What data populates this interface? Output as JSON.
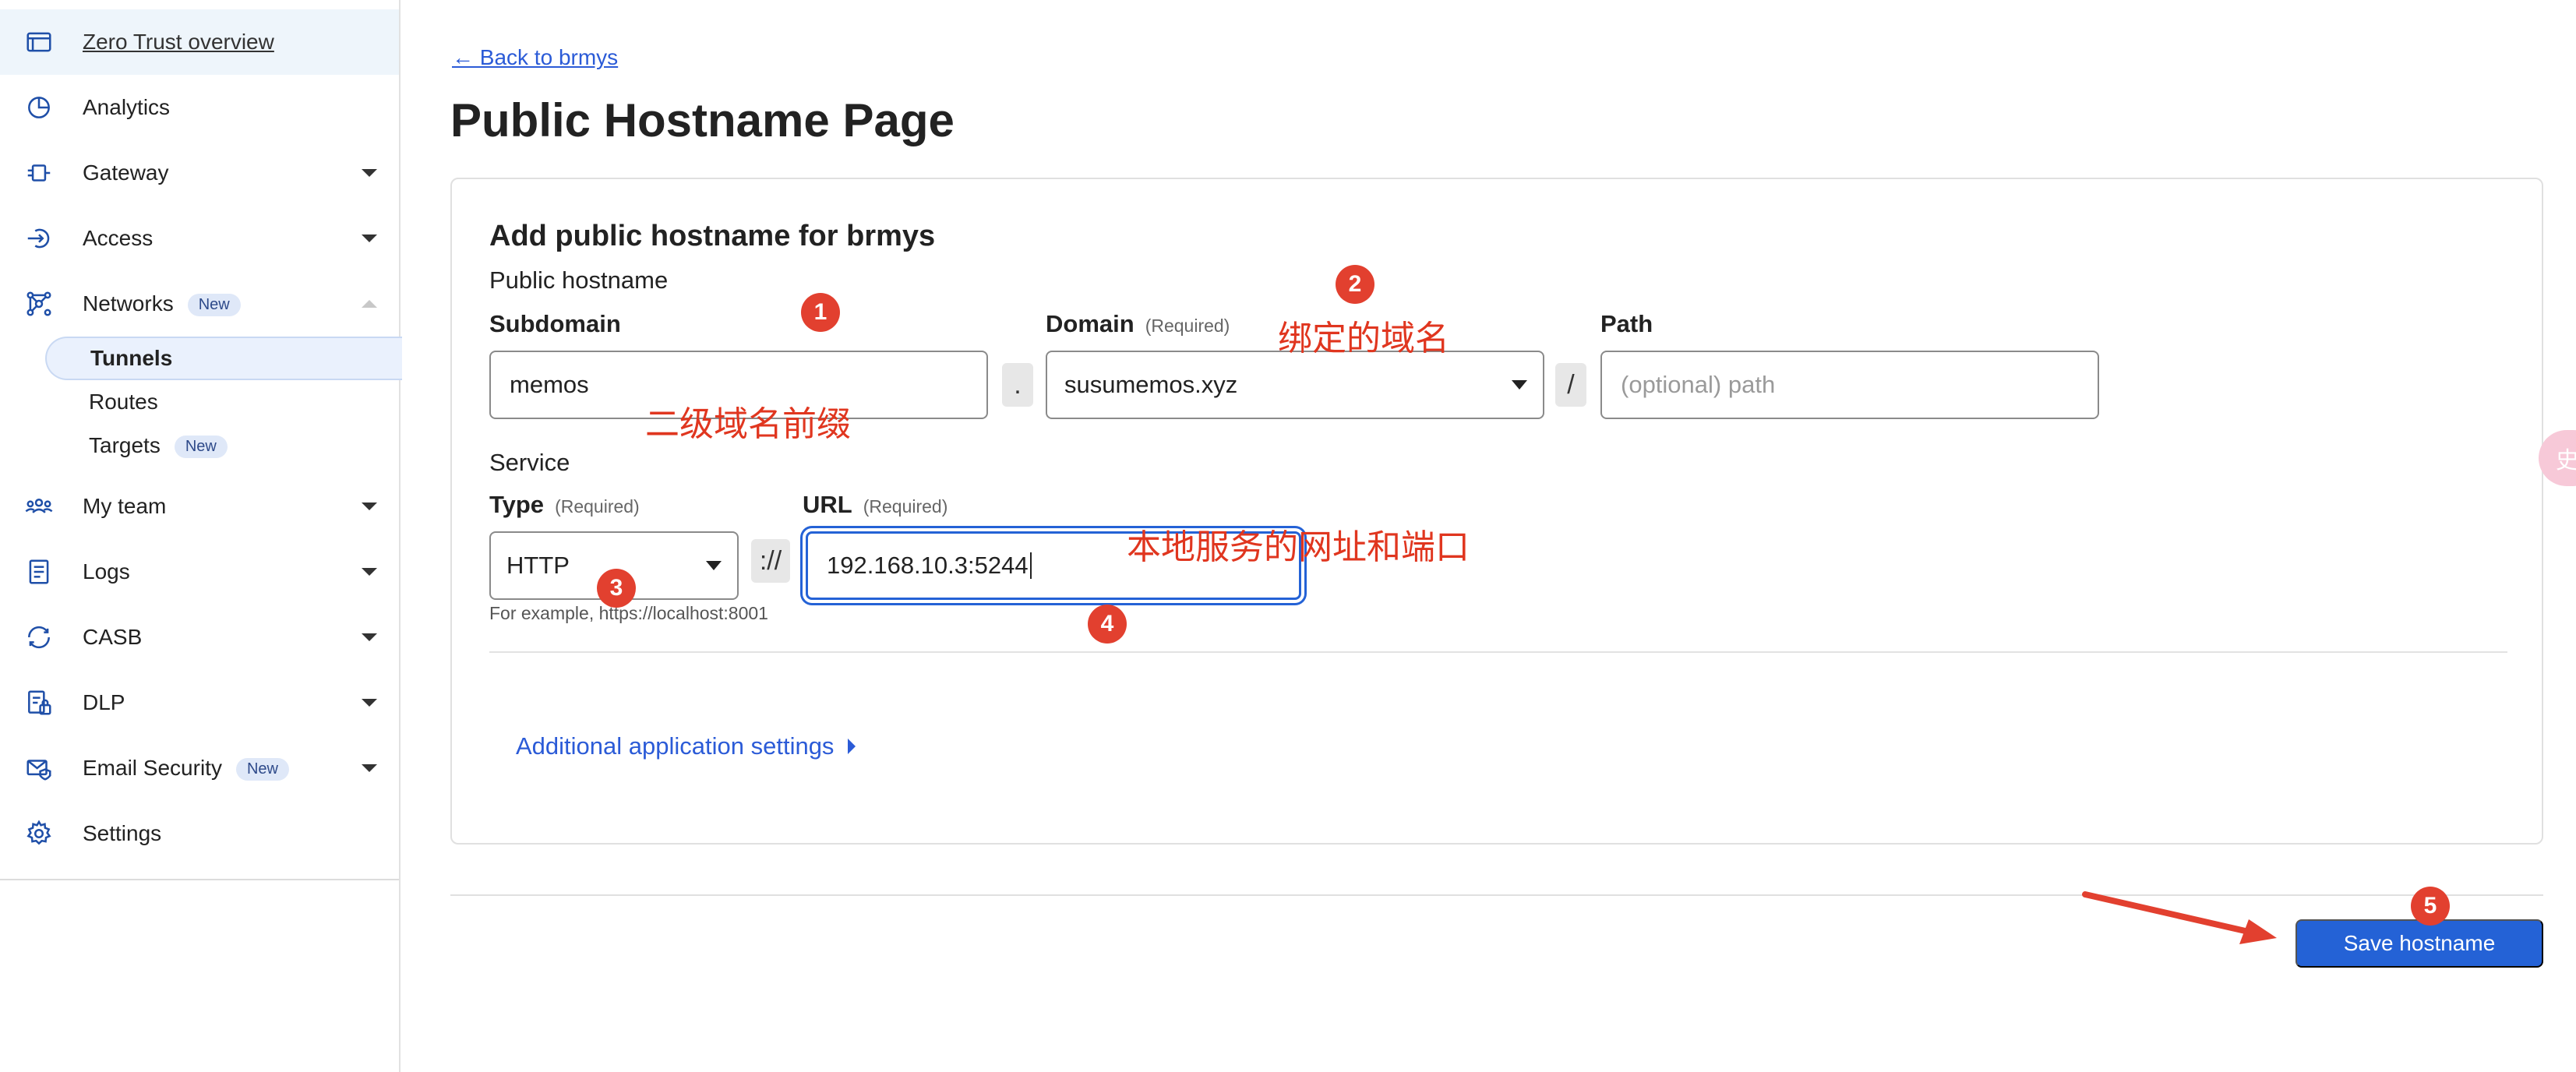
{
  "sidebar": {
    "items": [
      {
        "label": "Zero Trust overview",
        "icon": "browser-window-icon"
      },
      {
        "label": "Analytics",
        "icon": "pie-chart-icon"
      },
      {
        "label": "Gateway",
        "icon": "gateway-icon"
      },
      {
        "label": "Access",
        "icon": "access-icon"
      },
      {
        "label": "Networks",
        "icon": "network-icon",
        "badge": "New"
      },
      {
        "label": "My team",
        "icon": "team-icon"
      },
      {
        "label": "Logs",
        "icon": "logs-icon"
      },
      {
        "label": "CASB",
        "icon": "casb-icon"
      },
      {
        "label": "DLP",
        "icon": "dlp-icon"
      },
      {
        "label": "Email Security",
        "icon": "email-security-icon",
        "badge": "New"
      },
      {
        "label": "Settings",
        "icon": "gear-icon"
      }
    ],
    "networks_sub": [
      {
        "label": "Tunnels",
        "active": true
      },
      {
        "label": "Routes"
      },
      {
        "label": "Targets",
        "badge": "New"
      }
    ]
  },
  "main": {
    "back_link": "← Back to brmys",
    "page_title": "Public Hostname Page",
    "card": {
      "title": "Add public hostname for brmys",
      "public_hostname_label": "Public hostname",
      "subdomain": {
        "label": "Subdomain",
        "value": "memos"
      },
      "domain": {
        "label": "Domain",
        "required": "(Required)",
        "value": "susumemos.xyz"
      },
      "path": {
        "label": "Path",
        "placeholder": "(optional) path"
      },
      "dot_separator": ".",
      "slash_separator": "/",
      "service_label": "Service",
      "type": {
        "label": "Type",
        "required": "(Required)",
        "value": "HTTP"
      },
      "scheme_separator": "://",
      "url": {
        "label": "URL",
        "required": "(Required)",
        "value": "192.168.10.3:5244"
      },
      "help_text": "For example, https://localhost:8001",
      "additional_settings": "Additional application settings"
    },
    "save_button": "Save hostname"
  },
  "annotations": {
    "markers": [
      "1",
      "2",
      "3",
      "4",
      "5"
    ],
    "note_subdomain": "二级域名前缀",
    "note_domain": "绑定的域名",
    "note_url": "本地服务的网址和端口",
    "color": "#e2402f"
  },
  "edge_bubble": "史"
}
